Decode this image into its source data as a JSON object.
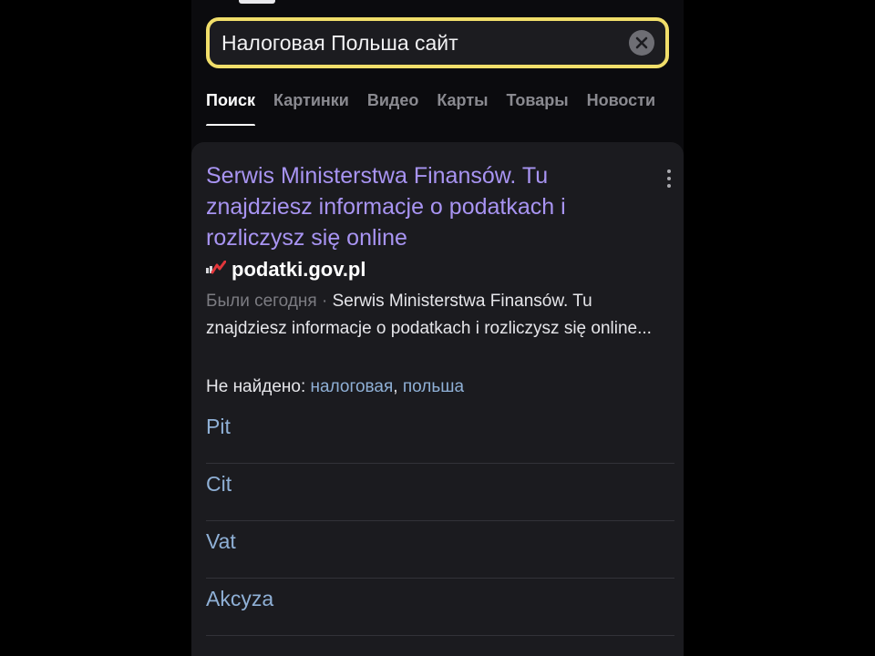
{
  "search": {
    "query": "Налоговая Польша сайт"
  },
  "tabs": [
    {
      "label": "Поиск",
      "active": true
    },
    {
      "label": "Картинки"
    },
    {
      "label": "Видео"
    },
    {
      "label": "Карты"
    },
    {
      "label": "Товары"
    },
    {
      "label": "Новости"
    }
  ],
  "result": {
    "title": "Serwis Ministerstwa Finansów. Tu znajdziesz informacje o podatkach i rozliczysz się online",
    "site": "podatki.gov.pl",
    "visited": "Были сегодня",
    "separator": "·",
    "snippet": "Serwis Ministerstwa Finansów. Tu znajdziesz informacje o podatkach i rozliczysz się online...",
    "not_found_label": "Не найдено:",
    "not_found_words": [
      "налоговая",
      "польша"
    ],
    "sitelinks": [
      "Pit",
      "Cit",
      "Vat",
      "Akcyza"
    ]
  },
  "colors": {
    "accent_border": "#f1de6a",
    "link_title": "#a894f2",
    "sitelink": "#8fb0d6"
  }
}
